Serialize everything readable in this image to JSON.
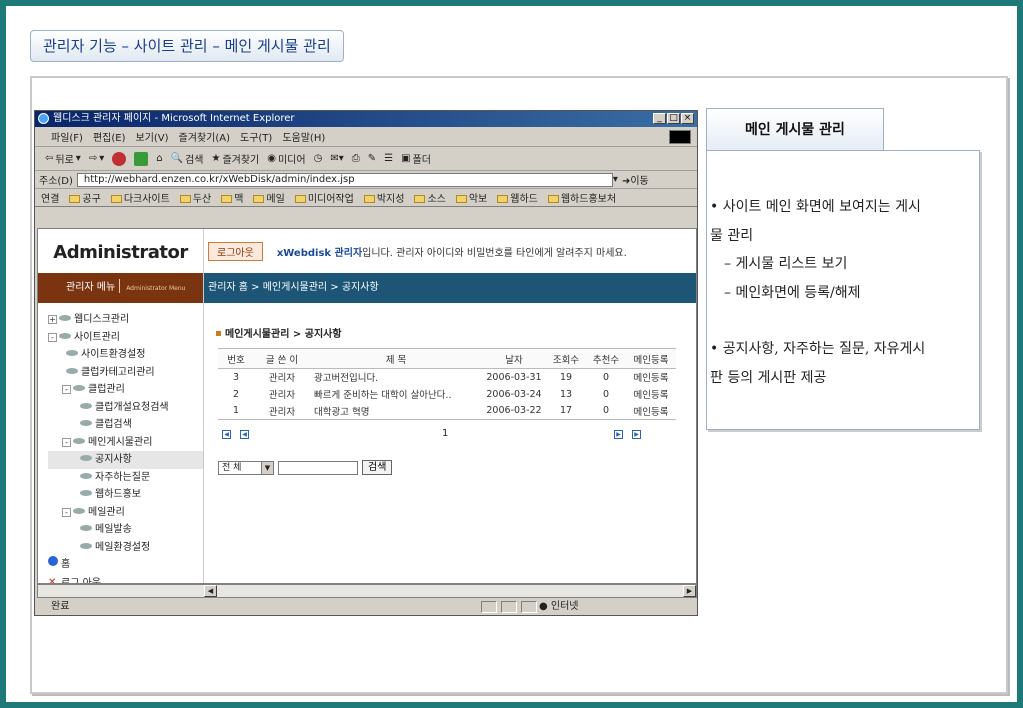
{
  "slide": {
    "title": "관리자 기능 – 사이트 관리 – 메인 게시물 관리"
  },
  "browser": {
    "window_title": "웹디스크 관리자 페이지 - Microsoft Internet Explorer",
    "menu": [
      "파일(F)",
      "편집(E)",
      "보기(V)",
      "즐겨찾기(A)",
      "도구(T)",
      "도움말(H)"
    ],
    "toolbar": {
      "back": "뒤로",
      "search": "검색",
      "favorites": "즐겨찾기",
      "media": "미디어",
      "folder": "폴더"
    },
    "address": {
      "label": "주소(D)",
      "url": "http://webhard.enzen.co.kr/xWebDisk/admin/index.jsp",
      "go": "이동"
    },
    "links": {
      "label": "연결",
      "items": [
        "공구",
        "다크사이트",
        "두산",
        "맥",
        "메일",
        "미디어작업",
        "박지성",
        "소스",
        "악보",
        "웹하드",
        "웹하드홍보처"
      ]
    },
    "status": {
      "text": "완료",
      "zone": "인터넷"
    }
  },
  "app": {
    "logo": "Administrator",
    "menu_title": "관리자 메뉴",
    "menu_subtitle": "Administrator Menu",
    "logout_button": "로그아웃",
    "welcome_bold": "xWebdisk 관리자",
    "welcome_rest": "입니다. 관리자 아이디와 비밀번호를 타인에게 알려주지 마세요.",
    "breadcrumb": "관리자 홈 > 메인게시물관리 > 공지사항",
    "section_title": "메인게시물관리 > 공지사항",
    "tree": [
      {
        "label": "웹디스크관리",
        "level": 0,
        "expander": "+"
      },
      {
        "label": "사이트관리",
        "level": 0,
        "expander": "-"
      },
      {
        "label": "사이트환경설정",
        "level": 1
      },
      {
        "label": "클럽카테고리관리",
        "level": 1
      },
      {
        "label": "클럽관리",
        "level": 1,
        "expander": "-"
      },
      {
        "label": "클럽개설요청검색",
        "level": 2
      },
      {
        "label": "클럽검색",
        "level": 2
      },
      {
        "label": "메인게시물관리",
        "level": 1,
        "expander": "-"
      },
      {
        "label": "공지사항",
        "level": 2,
        "selected": true
      },
      {
        "label": "자주하는질문",
        "level": 2
      },
      {
        "label": "웹하드홍보",
        "level": 2
      },
      {
        "label": "메일관리",
        "level": 1,
        "expander": "-"
      },
      {
        "label": "메일발송",
        "level": 2
      },
      {
        "label": "메일환경설정",
        "level": 2
      },
      {
        "label": "홈",
        "level": 0
      },
      {
        "label": "로그 아웃",
        "level": 0
      }
    ],
    "table": {
      "headers": [
        "번호",
        "글 쓴 이",
        "제 목",
        "날자",
        "조회수",
        "추천수",
        "메인등록"
      ],
      "rows": [
        [
          "3",
          "관리자",
          "광고버전입니다.",
          "2006-03-31",
          "19",
          "0",
          "메인등록"
        ],
        [
          "2",
          "관리자",
          "빠르게 준비하는 대학이 살아난다..",
          "2006-03-24",
          "13",
          "0",
          "메인등록"
        ],
        [
          "1",
          "관리자",
          "대학광고 혁명",
          "2006-03-22",
          "17",
          "0",
          "메인등록"
        ]
      ]
    },
    "pager": {
      "page": "1"
    },
    "search": {
      "select_value": "전 체",
      "button": "검색"
    }
  },
  "panel": {
    "title": "메인 게시물 관리",
    "bullet1_line1": "• 사이트 메인 화면에 보여지는 게시",
    "bullet1_line2": "물 관리",
    "sub1": "– 게시물 리스트 보기",
    "sub2": "– 메인화면에 등록/해제",
    "bullet2_line1": "• 공지사항, 자주하는 질문, 자유게시",
    "bullet2_line2": "판 등의 게시판 제공"
  }
}
